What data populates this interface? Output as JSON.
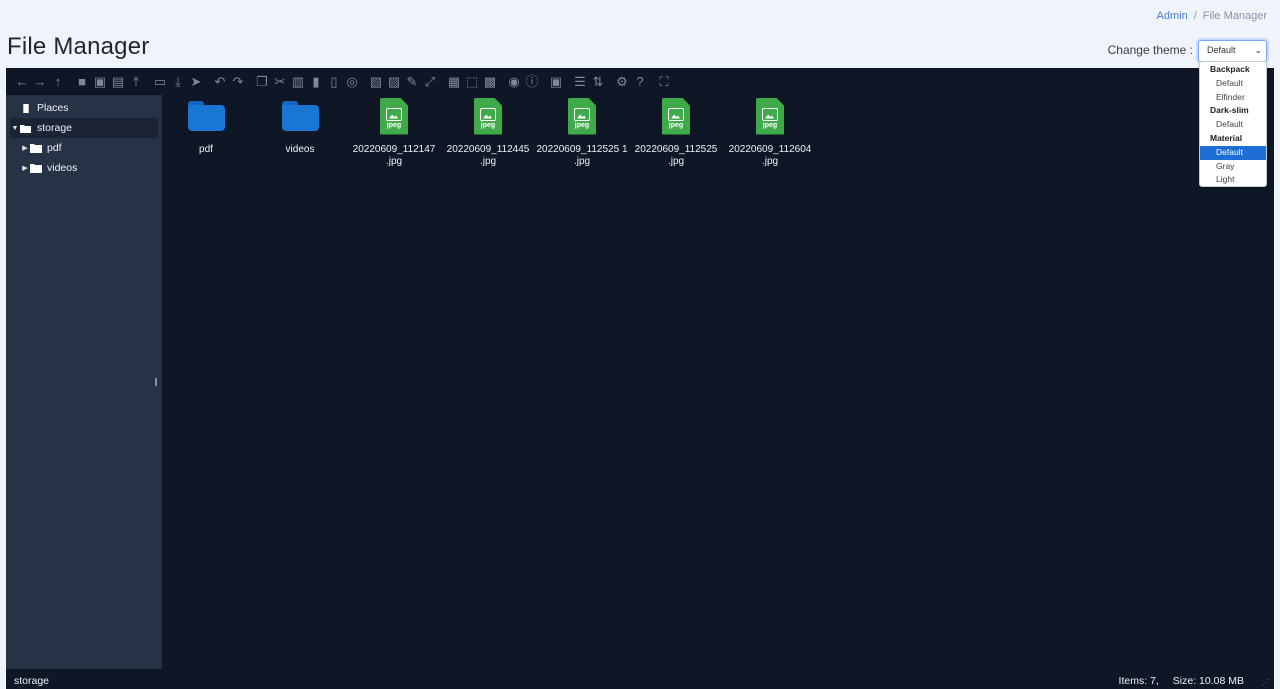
{
  "breadcrumb": {
    "items": [
      "Admin",
      "File Manager"
    ],
    "separator": "/"
  },
  "page": {
    "title": "File Manager"
  },
  "theme": {
    "label": "Change theme :",
    "selected": "Default",
    "groups": [
      {
        "label": "Backpack",
        "options": [
          "Default",
          "Elfinder"
        ]
      },
      {
        "label": "Dark-slim",
        "options": [
          "Default"
        ]
      },
      {
        "label": "Material",
        "options": [
          "Default",
          "Gray",
          "Light"
        ]
      }
    ],
    "highlighted": "Material/Default"
  },
  "toolbar": {
    "groups": [
      [
        "back-icon",
        "forward-icon",
        "up-icon"
      ],
      [
        "home-icon",
        "new-folder-icon",
        "new-file-icon",
        "upload-icon"
      ],
      [
        "open-icon",
        "download-icon",
        "select-icon"
      ],
      [
        "undo-icon",
        "redo-icon"
      ],
      [
        "copy-icon",
        "cut-icon",
        "paste-icon",
        "delete-icon",
        "trash-icon",
        "hide-icon"
      ],
      [
        "duplicate-icon",
        "rename-icon",
        "edit-icon",
        "resize-icon"
      ],
      [
        "select-all-icon",
        "select-none-icon",
        "invert-selection-icon"
      ],
      [
        "preview-icon",
        "info-icon"
      ],
      [
        "archive-icon"
      ],
      [
        "list-view-icon",
        "sort-icon"
      ],
      [
        "settings-icon",
        "help-icon"
      ],
      [
        "fullscreen-icon"
      ]
    ]
  },
  "navbar": {
    "places": "Places",
    "root": "storage",
    "children": [
      "pdf",
      "videos"
    ]
  },
  "files": [
    {
      "name": "pdf",
      "type": "folder"
    },
    {
      "name": "videos",
      "type": "folder"
    },
    {
      "name": "20220609_112147\n.jpg",
      "line1": "20220609_112147",
      "line2": ".jpg",
      "type": "jpeg"
    },
    {
      "name": "20220609_112445\n.jpg",
      "line1": "20220609_112445",
      "line2": ".jpg",
      "type": "jpeg"
    },
    {
      "name": "20220609_112525 1\n.jpg",
      "line1": "20220609_112525 1",
      "line2": ".jpg",
      "type": "jpeg"
    },
    {
      "name": "20220609_112525\n.jpg",
      "line1": "20220609_112525",
      "line2": ".jpg",
      "type": "jpeg"
    },
    {
      "name": "20220609_112604\n.jpg",
      "line1": "20220609_112604",
      "line2": ".jpg",
      "type": "jpeg"
    }
  ],
  "file_type_label": "jpeg",
  "statusbar": {
    "path": "storage",
    "items": "Items: 7,",
    "size": "Size: 10.08 MB"
  },
  "colors": {
    "folder": "#1976d2",
    "jpeg": "#3eaa4a",
    "panel_bg": "#0f1726",
    "nav_bg": "#263246",
    "accent": "#467fcf"
  }
}
